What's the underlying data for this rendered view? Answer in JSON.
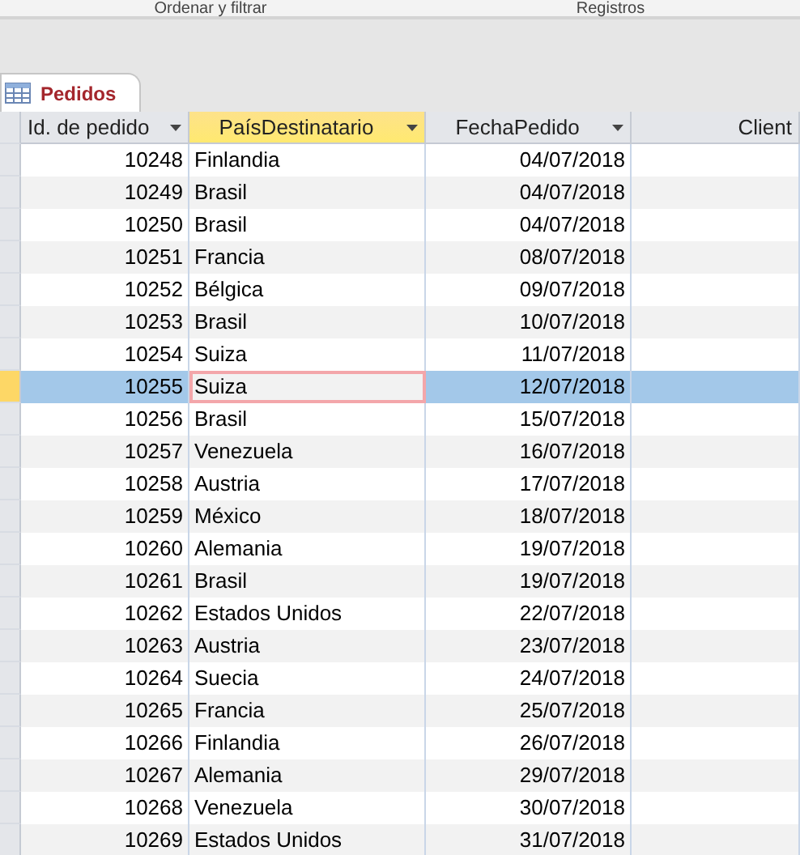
{
  "ribbon_groups": [
    "Ordenar y filtrar",
    "Registros"
  ],
  "tab": {
    "label": "Pedidos",
    "selected": true
  },
  "table": {
    "columns": [
      {
        "label": "Id. de pedido",
        "selected": false
      },
      {
        "label": "PaísDestinatario",
        "selected": true
      },
      {
        "label": "FechaPedido",
        "selected": false
      },
      {
        "label": "Client",
        "selected": false
      }
    ],
    "rows": [
      {
        "id": "10248",
        "country": "Finlandia",
        "date": "04/07/2018",
        "selected": false
      },
      {
        "id": "10249",
        "country": "Brasil",
        "date": "04/07/2018",
        "selected": false
      },
      {
        "id": "10250",
        "country": "Brasil",
        "date": "04/07/2018",
        "selected": false
      },
      {
        "id": "10251",
        "country": "Francia",
        "date": "08/07/2018",
        "selected": false
      },
      {
        "id": "10252",
        "country": "Bélgica",
        "date": "09/07/2018",
        "selected": false
      },
      {
        "id": "10253",
        "country": "Brasil",
        "date": "10/07/2018",
        "selected": false
      },
      {
        "id": "10254",
        "country": "Suiza",
        "date": "11/07/2018",
        "selected": false
      },
      {
        "id": "10255",
        "country": "Suiza",
        "date": "12/07/2018",
        "selected": true
      },
      {
        "id": "10256",
        "country": "Brasil",
        "date": "15/07/2018",
        "selected": false
      },
      {
        "id": "10257",
        "country": "Venezuela",
        "date": "16/07/2018",
        "selected": false
      },
      {
        "id": "10258",
        "country": "Austria",
        "date": "17/07/2018",
        "selected": false
      },
      {
        "id": "10259",
        "country": "México",
        "date": "18/07/2018",
        "selected": false
      },
      {
        "id": "10260",
        "country": "Alemania",
        "date": "19/07/2018",
        "selected": false
      },
      {
        "id": "10261",
        "country": "Brasil",
        "date": "19/07/2018",
        "selected": false
      },
      {
        "id": "10262",
        "country": "Estados Unidos",
        "date": "22/07/2018",
        "selected": false
      },
      {
        "id": "10263",
        "country": "Austria",
        "date": "23/07/2018",
        "selected": false
      },
      {
        "id": "10264",
        "country": "Suecia",
        "date": "24/07/2018",
        "selected": false
      },
      {
        "id": "10265",
        "country": "Francia",
        "date": "25/07/2018",
        "selected": false
      },
      {
        "id": "10266",
        "country": "Finlandia",
        "date": "26/07/2018",
        "selected": false
      },
      {
        "id": "10267",
        "country": "Alemania",
        "date": "29/07/2018",
        "selected": false
      },
      {
        "id": "10268",
        "country": "Venezuela",
        "date": "30/07/2018",
        "selected": false
      },
      {
        "id": "10269",
        "country": "Estados Unidos",
        "date": "31/07/2018",
        "selected": false
      }
    ]
  }
}
